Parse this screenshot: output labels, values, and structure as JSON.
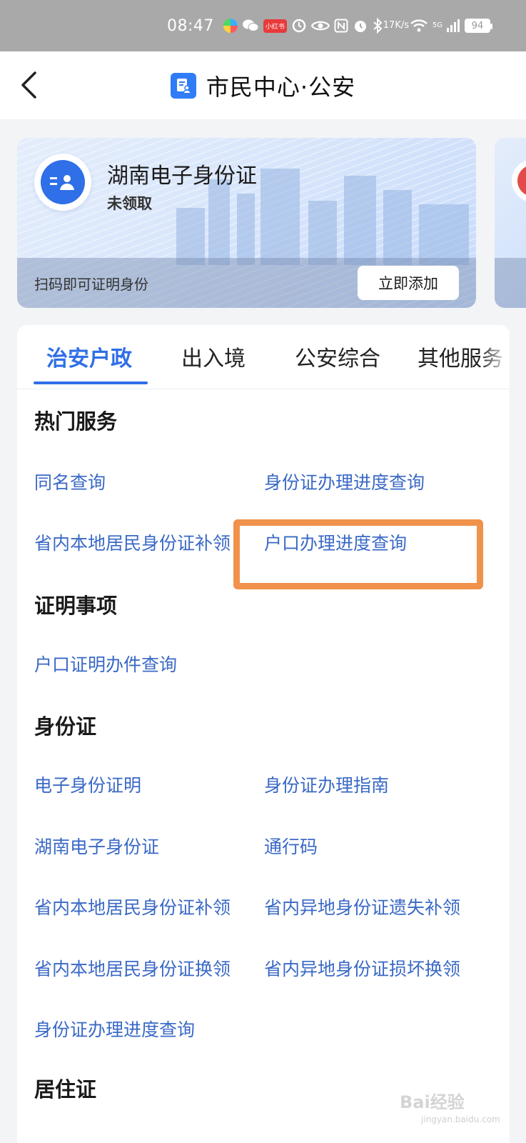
{
  "status_bar": {
    "time": "08:47",
    "speed_value": "17",
    "speed_unit": "K/s",
    "network": "5G",
    "battery": "94",
    "red_app_label": "小红书"
  },
  "header": {
    "title": "市民中心·公安",
    "back_icon": "chevron-left-icon",
    "title_icon": "document-person-icon"
  },
  "id_card": {
    "title": "湖南电子身份证",
    "status": "未领取",
    "hint": "扫码即可证明身份",
    "add_label": "立即添加",
    "avatar_icon": "id-card-icon"
  },
  "tabs": [
    {
      "label": "治安户政",
      "active": true
    },
    {
      "label": "出入境",
      "active": false
    },
    {
      "label": "公安综合",
      "active": false
    },
    {
      "label": "其他服务",
      "active": false
    }
  ],
  "sections": {
    "hot": {
      "title": "热门服务",
      "items": [
        "同名查询",
        "身份证办理进度查询",
        "省内本地居民身份证补领",
        "户口办理进度查询"
      ]
    },
    "certificate": {
      "title": "证明事项",
      "items": [
        "户口证明办件查询"
      ]
    },
    "id": {
      "title": "身份证",
      "items": [
        "电子身份证明",
        "身份证办理指南",
        "湖南电子身份证",
        "通行码",
        "省内本地居民身份证补领",
        "省内异地身份证遗失补领",
        "省内本地居民身份证换领",
        "省内异地身份证损坏换领",
        "身份证办理进度查询"
      ]
    },
    "residence": {
      "title": "居住证"
    }
  },
  "colors": {
    "accent": "#2f6fe8",
    "link": "#3a69c6",
    "highlight": "#f0924b"
  },
  "watermark": {
    "text": "Bai经验",
    "sub": "jingyan.baidu.com"
  }
}
